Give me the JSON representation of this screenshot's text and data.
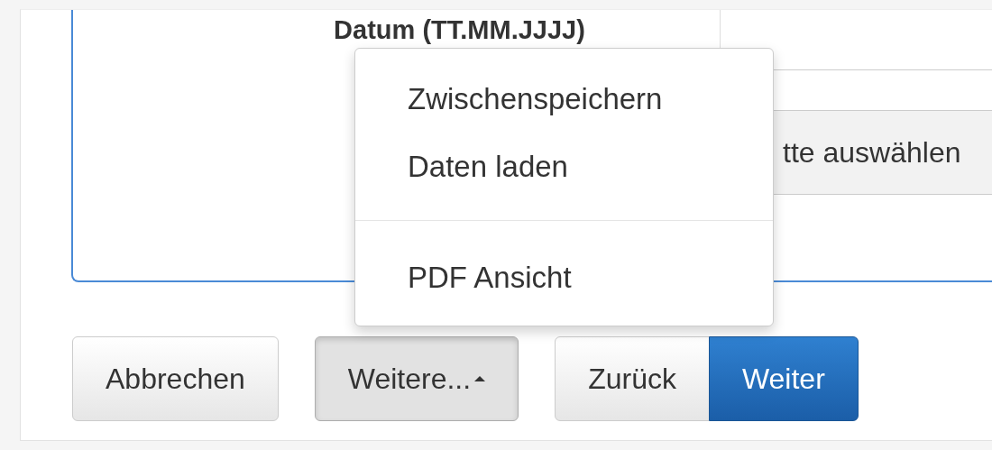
{
  "field": {
    "label": "Datum (TT.MM.JJJJ)",
    "select_text": "tte auswählen"
  },
  "menu": [
    {
      "kind": "item",
      "label": "Zwischenspeichern"
    },
    {
      "kind": "item",
      "label": "Daten laden"
    },
    {
      "kind": "divider"
    },
    {
      "kind": "item",
      "label": "PDF Ansicht"
    }
  ],
  "button_groups": [
    [
      {
        "label": "Abbrechen",
        "kind": "default"
      }
    ],
    [
      {
        "label": "Weitere...",
        "kind": "dropdown",
        "expanded": true
      }
    ],
    [
      {
        "label": "Zurück",
        "kind": "default"
      },
      {
        "label": "Weiter",
        "kind": "primary"
      }
    ]
  ]
}
